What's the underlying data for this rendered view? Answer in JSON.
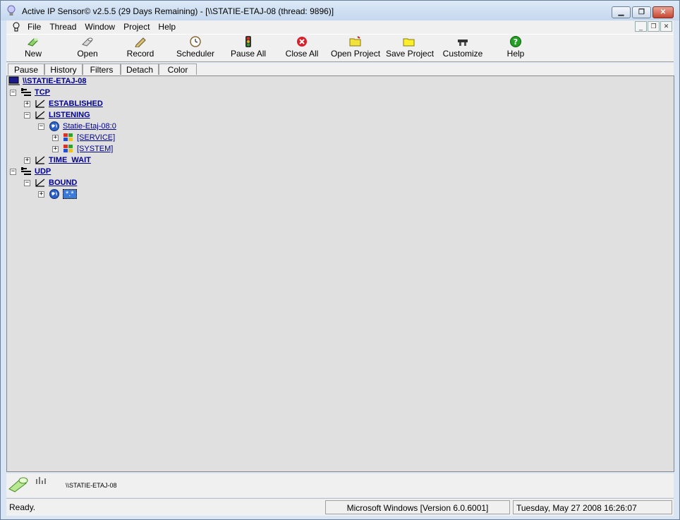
{
  "window": {
    "title": "Active IP Sensor© v2.5.5 (29 Days Remaining) - [\\\\STATIE-ETAJ-08 (thread: 9896)]"
  },
  "menu": [
    "File",
    "Thread",
    "Window",
    "Project",
    "Help"
  ],
  "toolbar": {
    "new": "New",
    "open": "Open",
    "record": "Record",
    "scheduler": "Scheduler",
    "pause_all": "Pause All",
    "close_all": "Close All",
    "open_project": "Open Project",
    "save_project": "Save Project",
    "customize": "Customize",
    "help": "Help"
  },
  "tabs": [
    "Pause",
    "History",
    "Filters",
    "Detach",
    "Color"
  ],
  "tree": {
    "root": "\\\\STATIE-ETAJ-08",
    "tcp": "TCP",
    "established": "ESTABLISHED",
    "listening": "LISTENING",
    "listen_host": "Statie-Etaj-08:0",
    "service": "[SERVICE]",
    "system": "[SYSTEM]",
    "time_wait": "TIME_WAIT",
    "udp": "UDP",
    "bound": "BOUND",
    "bound_item": "*.*"
  },
  "info": {
    "host": "\\\\STATIE-ETAJ-08"
  },
  "status": {
    "left": "Ready.",
    "os": "Microsoft Windows [Version 6.0.6001]",
    "datetime": "Tuesday, May 27 2008 16:26:07"
  }
}
